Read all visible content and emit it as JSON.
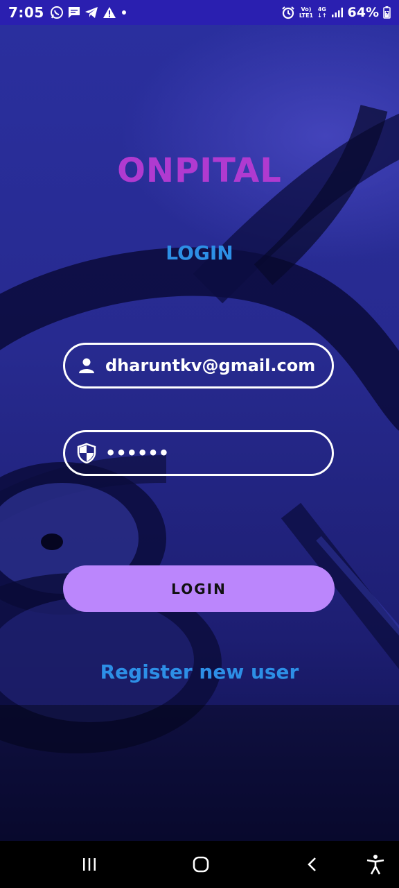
{
  "status_bar": {
    "time": "7:05",
    "net_top": "Vo)",
    "net_bottom": "LTE1",
    "net_type": "4G",
    "battery": "64%",
    "icons": [
      "whatsapp-icon",
      "message-icon",
      "telegram-icon",
      "warning-icon",
      "dot-icon",
      "alarm-icon",
      "signal-icon",
      "battery-icon"
    ]
  },
  "app": {
    "title": "ONPITAL",
    "heading": "LOGIN"
  },
  "form": {
    "email_value": "dharuntkv@gmail.com",
    "password_value": "••••••",
    "email_icon": "person-icon",
    "password_icon": "shield-icon"
  },
  "actions": {
    "login_label": "LOGIN",
    "register_label": "Register new user"
  },
  "colors": {
    "title": "#b03ad0",
    "link": "#2d8fe6",
    "button": "#bb86fc",
    "status_bar": "#2a1fb0"
  },
  "nav_bar": {
    "icons": [
      "recents-icon",
      "home-icon",
      "back-icon",
      "accessibility-icon"
    ]
  }
}
